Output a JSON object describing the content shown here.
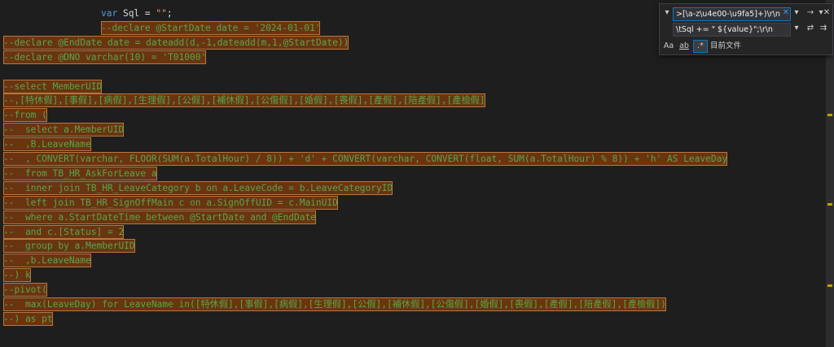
{
  "editor": {
    "lines": [
      {
        "indent": 120,
        "highlight": false,
        "tokens": [
          {
            "t": "kw",
            "v": "var"
          },
          {
            "t": "id",
            "v": " Sql = "
          },
          {
            "t": "str",
            "v": "\"\""
          },
          {
            "t": "id",
            "v": ";"
          }
        ]
      },
      {
        "indent": 120,
        "highlight": true,
        "tokens": [
          {
            "t": "cm",
            "v": "--declare @StartDate date = '2024-01-01'"
          }
        ]
      },
      {
        "indent": 0,
        "highlight": true,
        "tokens": [
          {
            "t": "cm",
            "v": "--declare @EndDate date = dateadd(d,-1,dateadd(m,1,@StartDate))"
          }
        ]
      },
      {
        "indent": 0,
        "highlight": true,
        "tokens": [
          {
            "t": "cm",
            "v": "--declare @DNO varchar(10) = 'T01000'"
          }
        ]
      },
      {
        "indent": 0,
        "highlight": false,
        "tokens": []
      },
      {
        "indent": 0,
        "highlight": true,
        "tokens": [
          {
            "t": "cm",
            "v": "--select MemberUID"
          }
        ]
      },
      {
        "indent": 0,
        "highlight": true,
        "tokens": [
          {
            "t": "cm",
            "v": "--,[特休假],[事假],[病假],[生理假],[公假],[補休假],[公傷假],[婚假],[喪假],[產假],[陪產假],[產檢假]"
          }
        ]
      },
      {
        "indent": 0,
        "highlight": true,
        "tokens": [
          {
            "t": "cm",
            "v": "--from ("
          }
        ]
      },
      {
        "indent": 0,
        "highlight": true,
        "tokens": [
          {
            "t": "cm",
            "v": "--  select a.MemberUID"
          }
        ]
      },
      {
        "indent": 0,
        "highlight": true,
        "tokens": [
          {
            "t": "cm",
            "v": "--  ,B.LeaveName"
          }
        ]
      },
      {
        "indent": 0,
        "highlight": true,
        "tokens": [
          {
            "t": "cm",
            "v": "--  , CONVERT(varchar, FLOOR(SUM(a.TotalHour) / 8)) + 'd' + CONVERT(varchar, CONVERT(float, SUM(a.TotalHour) % 8)) + 'h' AS LeaveDay"
          }
        ]
      },
      {
        "indent": 0,
        "highlight": true,
        "tokens": [
          {
            "t": "cm",
            "v": "--  from TB_HR_AskForLeave a"
          }
        ]
      },
      {
        "indent": 0,
        "highlight": true,
        "tokens": [
          {
            "t": "cm",
            "v": "--  inner join TB_HR_LeaveCategory b on a.LeaveCode = b.LeaveCategoryID"
          }
        ]
      },
      {
        "indent": 0,
        "highlight": true,
        "tokens": [
          {
            "t": "cm",
            "v": "--  left join TB_HR_SignOffMain c on a.SignOffUID = c.MainUID"
          }
        ]
      },
      {
        "indent": 0,
        "highlight": true,
        "tokens": [
          {
            "t": "cm",
            "v": "--  where a.StartDateTime between @StartDate and @EndDate"
          }
        ]
      },
      {
        "indent": 0,
        "highlight": true,
        "tokens": [
          {
            "t": "cm",
            "v": "--  and c.[Status] = 2"
          }
        ]
      },
      {
        "indent": 0,
        "highlight": true,
        "tokens": [
          {
            "t": "cm",
            "v": "--  group by a.MemberUID"
          }
        ]
      },
      {
        "indent": 0,
        "highlight": true,
        "tokens": [
          {
            "t": "cm",
            "v": "--  ,b.LeaveName"
          }
        ]
      },
      {
        "indent": 0,
        "highlight": true,
        "tokens": [
          {
            "t": "cm",
            "v": "--) k"
          }
        ]
      },
      {
        "indent": 0,
        "highlight": true,
        "tokens": [
          {
            "t": "cm",
            "v": "--pivot("
          }
        ]
      },
      {
        "indent": 0,
        "highlight": true,
        "tokens": [
          {
            "t": "cm",
            "v": "--  max(LeaveDay) for LeaveName in([特休假],[事假],[病假],[生理假],[公假],[補休假],[公傷假],[婚假],[喪假],[產假],[陪產假],[產檢假])"
          }
        ]
      },
      {
        "indent": 0,
        "highlight": true,
        "tokens": [
          {
            "t": "cm",
            "v": "--) as pt"
          }
        ]
      }
    ]
  },
  "find_replace": {
    "find_value": ">[\\a-z\\u4e00-\\u9fa5]+)\\r\\n",
    "replace_value": "\\tSql += \" ${value}\";\\r\\n",
    "clear_label": "✕",
    "find_dropdown_label": "▾",
    "next_label": "→",
    "options_label": "▾",
    "close_label": "✕",
    "replace_dropdown_label": "▾",
    "replace_next_label": "⇄",
    "replace_all_label": "⇉",
    "match_case_label": "Aa",
    "whole_word_label": "ab",
    "regex_label": ".*",
    "scope_label": "目前文件",
    "scope_dropdown_label": "▾"
  },
  "colors": {
    "background": "#1e1e1e",
    "highlight_fill": "#6a3411",
    "highlight_border": "#b9773f",
    "comment": "#57a64a",
    "keyword": "#569cd6",
    "string": "#d69d85",
    "accent": "#007acc"
  }
}
